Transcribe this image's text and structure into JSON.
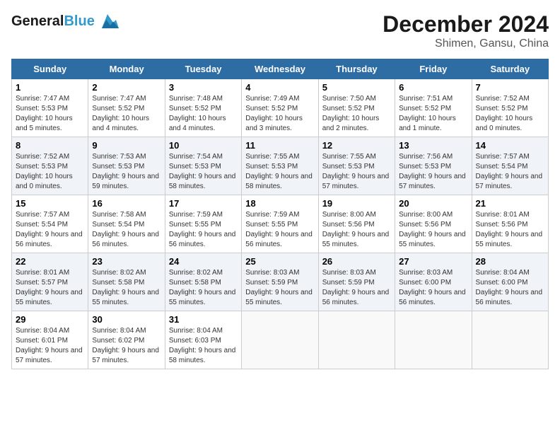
{
  "header": {
    "logo_line1": "General",
    "logo_line2": "Blue",
    "month": "December 2024",
    "location": "Shimen, Gansu, China"
  },
  "weekdays": [
    "Sunday",
    "Monday",
    "Tuesday",
    "Wednesday",
    "Thursday",
    "Friday",
    "Saturday"
  ],
  "weeks": [
    [
      {
        "day": "1",
        "sunrise": "7:47 AM",
        "sunset": "5:53 PM",
        "daylight": "10 hours and 5 minutes."
      },
      {
        "day": "2",
        "sunrise": "7:47 AM",
        "sunset": "5:52 PM",
        "daylight": "10 hours and 4 minutes."
      },
      {
        "day": "3",
        "sunrise": "7:48 AM",
        "sunset": "5:52 PM",
        "daylight": "10 hours and 4 minutes."
      },
      {
        "day": "4",
        "sunrise": "7:49 AM",
        "sunset": "5:52 PM",
        "daylight": "10 hours and 3 minutes."
      },
      {
        "day": "5",
        "sunrise": "7:50 AM",
        "sunset": "5:52 PM",
        "daylight": "10 hours and 2 minutes."
      },
      {
        "day": "6",
        "sunrise": "7:51 AM",
        "sunset": "5:52 PM",
        "daylight": "10 hours and 1 minute."
      },
      {
        "day": "7",
        "sunrise": "7:52 AM",
        "sunset": "5:52 PM",
        "daylight": "10 hours and 0 minutes."
      }
    ],
    [
      {
        "day": "8",
        "sunrise": "7:52 AM",
        "sunset": "5:53 PM",
        "daylight": "10 hours and 0 minutes."
      },
      {
        "day": "9",
        "sunrise": "7:53 AM",
        "sunset": "5:53 PM",
        "daylight": "9 hours and 59 minutes."
      },
      {
        "day": "10",
        "sunrise": "7:54 AM",
        "sunset": "5:53 PM",
        "daylight": "9 hours and 58 minutes."
      },
      {
        "day": "11",
        "sunrise": "7:55 AM",
        "sunset": "5:53 PM",
        "daylight": "9 hours and 58 minutes."
      },
      {
        "day": "12",
        "sunrise": "7:55 AM",
        "sunset": "5:53 PM",
        "daylight": "9 hours and 57 minutes."
      },
      {
        "day": "13",
        "sunrise": "7:56 AM",
        "sunset": "5:53 PM",
        "daylight": "9 hours and 57 minutes."
      },
      {
        "day": "14",
        "sunrise": "7:57 AM",
        "sunset": "5:54 PM",
        "daylight": "9 hours and 57 minutes."
      }
    ],
    [
      {
        "day": "15",
        "sunrise": "7:57 AM",
        "sunset": "5:54 PM",
        "daylight": "9 hours and 56 minutes."
      },
      {
        "day": "16",
        "sunrise": "7:58 AM",
        "sunset": "5:54 PM",
        "daylight": "9 hours and 56 minutes."
      },
      {
        "day": "17",
        "sunrise": "7:59 AM",
        "sunset": "5:55 PM",
        "daylight": "9 hours and 56 minutes."
      },
      {
        "day": "18",
        "sunrise": "7:59 AM",
        "sunset": "5:55 PM",
        "daylight": "9 hours and 56 minutes."
      },
      {
        "day": "19",
        "sunrise": "8:00 AM",
        "sunset": "5:56 PM",
        "daylight": "9 hours and 55 minutes."
      },
      {
        "day": "20",
        "sunrise": "8:00 AM",
        "sunset": "5:56 PM",
        "daylight": "9 hours and 55 minutes."
      },
      {
        "day": "21",
        "sunrise": "8:01 AM",
        "sunset": "5:56 PM",
        "daylight": "9 hours and 55 minutes."
      }
    ],
    [
      {
        "day": "22",
        "sunrise": "8:01 AM",
        "sunset": "5:57 PM",
        "daylight": "9 hours and 55 minutes."
      },
      {
        "day": "23",
        "sunrise": "8:02 AM",
        "sunset": "5:58 PM",
        "daylight": "9 hours and 55 minutes."
      },
      {
        "day": "24",
        "sunrise": "8:02 AM",
        "sunset": "5:58 PM",
        "daylight": "9 hours and 55 minutes."
      },
      {
        "day": "25",
        "sunrise": "8:03 AM",
        "sunset": "5:59 PM",
        "daylight": "9 hours and 55 minutes."
      },
      {
        "day": "26",
        "sunrise": "8:03 AM",
        "sunset": "5:59 PM",
        "daylight": "9 hours and 56 minutes."
      },
      {
        "day": "27",
        "sunrise": "8:03 AM",
        "sunset": "6:00 PM",
        "daylight": "9 hours and 56 minutes."
      },
      {
        "day": "28",
        "sunrise": "8:04 AM",
        "sunset": "6:00 PM",
        "daylight": "9 hours and 56 minutes."
      }
    ],
    [
      {
        "day": "29",
        "sunrise": "8:04 AM",
        "sunset": "6:01 PM",
        "daylight": "9 hours and 57 minutes."
      },
      {
        "day": "30",
        "sunrise": "8:04 AM",
        "sunset": "6:02 PM",
        "daylight": "9 hours and 57 minutes."
      },
      {
        "day": "31",
        "sunrise": "8:04 AM",
        "sunset": "6:03 PM",
        "daylight": "9 hours and 58 minutes."
      },
      null,
      null,
      null,
      null
    ]
  ]
}
